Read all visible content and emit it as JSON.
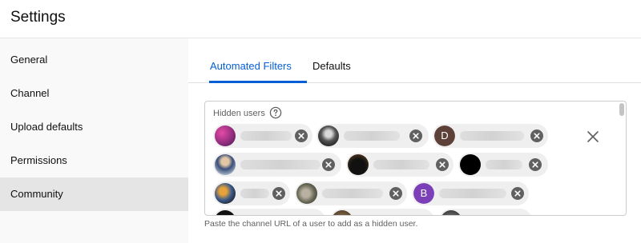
{
  "header": {
    "title": "Settings"
  },
  "sidebar": {
    "items": [
      {
        "label": "General"
      },
      {
        "label": "Channel"
      },
      {
        "label": "Upload defaults"
      },
      {
        "label": "Permissions"
      },
      {
        "label": "Community",
        "active": true
      }
    ]
  },
  "tabs": [
    {
      "label": "Automated Filters",
      "active": true
    },
    {
      "label": "Defaults"
    }
  ],
  "hidden_users": {
    "label": "Hidden users",
    "avatar_letters": [
      "D",
      "B"
    ],
    "colors": {
      "avatar_d": "#5d4037",
      "avatar_b": "#7b3fb8"
    }
  },
  "hint": "Paste the channel URL of a user to add as a hidden user.",
  "colors": {
    "accent": "#065fd4",
    "sidebar_active": "#e5e5e5"
  }
}
